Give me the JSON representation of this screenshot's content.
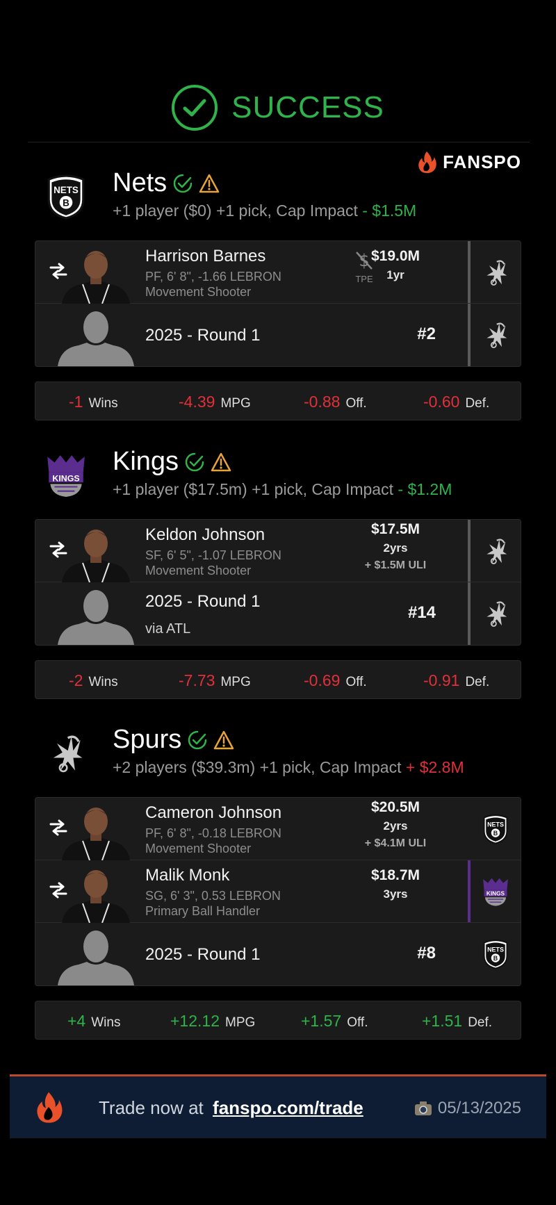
{
  "header": {
    "status": "SUCCESS",
    "brand": "FANSPO"
  },
  "teams": [
    {
      "name": "Nets",
      "summary_prefix": "+1 player ($0) +1 pick, Cap Impact",
      "cap_sign": "-",
      "cap_value": "$1.5M",
      "assets": [
        {
          "type": "player",
          "name": "Harrison Barnes",
          "info": "PF, 6' 8\", -1.66 LEBRON",
          "role": "Movement Shooter",
          "tpe_label": "TPE",
          "amount": "$19.0M",
          "years": "1yr"
        },
        {
          "type": "pick",
          "title": "2025 - Round 1",
          "number": "#2"
        }
      ],
      "stats": {
        "wins": "-1",
        "mpg": "-4.39",
        "off": "-0.88",
        "def": "-0.60"
      }
    },
    {
      "name": "Kings",
      "summary_prefix": "+1 player ($17.5m) +1 pick, Cap Impact",
      "cap_sign": "-",
      "cap_value": "$1.2M",
      "assets": [
        {
          "type": "player",
          "name": "Keldon Johnson",
          "info": "SF, 6' 5\", -1.07 LEBRON",
          "role": "Movement Shooter",
          "amount": "$17.5M",
          "years": "2yrs",
          "uli": "+ $1.5M ULI"
        },
        {
          "type": "pick",
          "title": "2025 - Round 1",
          "via": "via ATL",
          "number": "#14"
        }
      ],
      "stats": {
        "wins": "-2",
        "mpg": "-7.73",
        "off": "-0.69",
        "def": "-0.91"
      }
    },
    {
      "name": "Spurs",
      "summary_prefix": "+2 players ($39.3m) +1 pick, Cap Impact",
      "cap_sign": "+",
      "cap_value": "$2.8M",
      "assets": [
        {
          "type": "player",
          "name": "Cameron Johnson",
          "info": "PF, 6' 8\", -0.18 LEBRON",
          "role": "Movement Shooter",
          "amount": "$20.5M",
          "years": "2yrs",
          "uli": "+ $4.1M ULI"
        },
        {
          "type": "player",
          "name": "Malik Monk",
          "info": "SG, 6' 3\", 0.53 LEBRON",
          "role": "Primary Ball Handler",
          "amount": "$18.7M",
          "years": "3yrs"
        },
        {
          "type": "pick",
          "title": "2025 - Round 1",
          "number": "#8"
        }
      ],
      "stats": {
        "wins": "+4",
        "mpg": "+12.12",
        "off": "+1.57",
        "def": "+1.51"
      }
    }
  ],
  "stat_labels": {
    "wins": "Wins",
    "mpg": "MPG",
    "off": "Off.",
    "def": "Def."
  },
  "footer": {
    "cta_prefix": "Trade now at",
    "cta_link": "fanspo.com/trade",
    "date": "05/13/2025"
  },
  "colors": {
    "positive": "#2fb34a",
    "negative": "#e0303a",
    "brand_flame": "#e8512a",
    "footer_bg": "#0e1d33"
  },
  "icons": [
    "check-circle-icon",
    "fanspo-flame-icon",
    "nets-logo",
    "kings-logo",
    "spurs-logo",
    "verified-check-icon",
    "warning-triangle-icon",
    "swap-arrows-icon",
    "no-salary-icon",
    "camera-icon"
  ]
}
